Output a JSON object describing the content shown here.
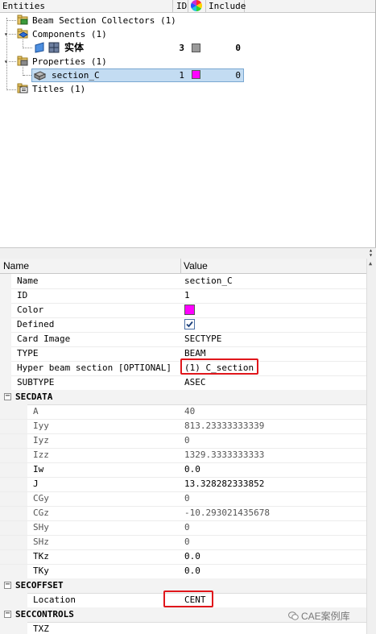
{
  "entity_browser": {
    "columns": {
      "entities": "Entities",
      "id": "ID",
      "include": "Include"
    },
    "rows": [
      {
        "label": "Beam Section Collectors (1)",
        "icon": "beam-section-collector-icon",
        "id": "",
        "color": "",
        "include": ""
      },
      {
        "label": "Components (1)",
        "icon": "component-folder-icon",
        "id": "",
        "color": "",
        "include": ""
      },
      {
        "label": "实体",
        "icon": "component-icon",
        "id": "3",
        "color": "#9a9a9a",
        "include": "0"
      },
      {
        "label": "Properties (1)",
        "icon": "property-folder-icon",
        "id": "",
        "color": "",
        "include": ""
      },
      {
        "label": "section_C",
        "icon": "property-icon",
        "id": "1",
        "color": "#ff00ff",
        "include": "0",
        "selected": true
      },
      {
        "label": "Titles (1)",
        "icon": "titles-icon",
        "id": "",
        "color": "",
        "include": ""
      }
    ]
  },
  "property_panel": {
    "columns": {
      "name": "Name",
      "value": "Value"
    },
    "rows": [
      {
        "name": "Name",
        "value": "section_C"
      },
      {
        "name": "ID",
        "value": "1"
      },
      {
        "name": "Color",
        "value": "",
        "swatch": "#ff00ff"
      },
      {
        "name": "Defined",
        "value": "",
        "checkbox": true
      },
      {
        "name": "Card Image",
        "value": "SECTYPE"
      },
      {
        "name": "TYPE",
        "value": "BEAM"
      },
      {
        "name": "Hyper beam section [OPTIONAL]",
        "value": "(1) C_section",
        "highlighted": true
      },
      {
        "name": "SUBTYPE",
        "value": "ASEC"
      }
    ],
    "groups": [
      {
        "name": "SECDATA",
        "rows": [
          {
            "name": "A",
            "value": "40"
          },
          {
            "name": "Iyy",
            "value": "813.23333333339"
          },
          {
            "name": "Iyz",
            "value": "0"
          },
          {
            "name": "Izz",
            "value": "1329.3333333333"
          },
          {
            "name": "Iw",
            "value": "0.0"
          },
          {
            "name": "J",
            "value": "13.328282333852"
          },
          {
            "name": "CGy",
            "value": "0"
          },
          {
            "name": "CGz",
            "value": "-10.293021435678"
          },
          {
            "name": "SHy",
            "value": "0"
          },
          {
            "name": "SHz",
            "value": "0"
          },
          {
            "name": "TKz",
            "value": "0.0"
          },
          {
            "name": "TKy",
            "value": "0.0"
          }
        ]
      },
      {
        "name": "SECOFFSET",
        "rows": [
          {
            "name": "Location",
            "value": "CENT",
            "highlighted": true
          }
        ]
      },
      {
        "name": "SECCONTROLS",
        "rows": [
          {
            "name": "TXZ",
            "value": ""
          }
        ]
      }
    ],
    "toggle_symbol": "−"
  },
  "watermark": {
    "text": "CAE案例库"
  },
  "colors": {
    "highlight_box": "#e0161b",
    "selection": "#c3dcf2",
    "magenta": "#ff00ff"
  }
}
